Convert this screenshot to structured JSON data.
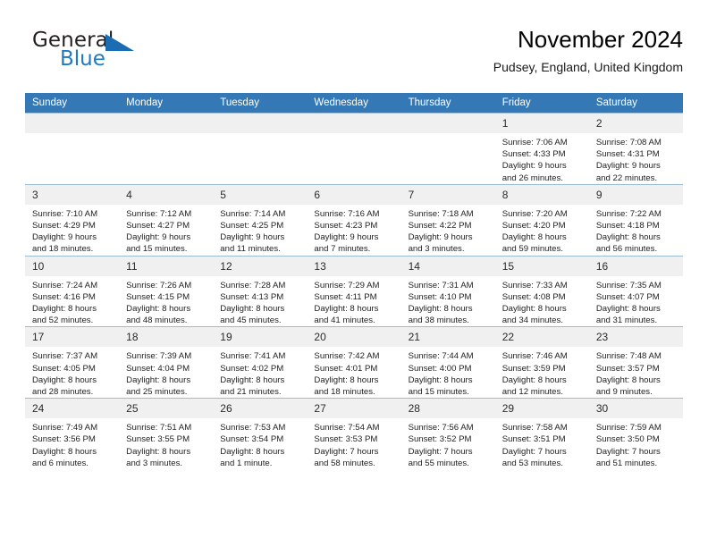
{
  "brand": {
    "name_part1": "General",
    "name_part2": "Blue",
    "logo_color": "#1b6cb3"
  },
  "header": {
    "title": "November 2024",
    "subtitle": "Pudsey, England, United Kingdom"
  },
  "theme": {
    "header_row_bg": "#3479b6",
    "daynum_bg": "#f0f0f0",
    "grid_line": "#9dbbd4"
  },
  "weekdays": [
    "Sunday",
    "Monday",
    "Tuesday",
    "Wednesday",
    "Thursday",
    "Friday",
    "Saturday"
  ],
  "labels": {
    "sunrise": "Sunrise:",
    "sunset": "Sunset:",
    "daylight": "Daylight:"
  },
  "weeks": [
    [
      {
        "day": "",
        "blank": true
      },
      {
        "day": "",
        "blank": true
      },
      {
        "day": "",
        "blank": true
      },
      {
        "day": "",
        "blank": true
      },
      {
        "day": "",
        "blank": true
      },
      {
        "day": "1",
        "sunrise": "Sunrise: 7:06 AM",
        "sunset": "Sunset: 4:33 PM",
        "daylight_line1": "Daylight: 9 hours",
        "daylight_line2": "and 26 minutes."
      },
      {
        "day": "2",
        "sunrise": "Sunrise: 7:08 AM",
        "sunset": "Sunset: 4:31 PM",
        "daylight_line1": "Daylight: 9 hours",
        "daylight_line2": "and 22 minutes."
      }
    ],
    [
      {
        "day": "3",
        "sunrise": "Sunrise: 7:10 AM",
        "sunset": "Sunset: 4:29 PM",
        "daylight_line1": "Daylight: 9 hours",
        "daylight_line2": "and 18 minutes."
      },
      {
        "day": "4",
        "sunrise": "Sunrise: 7:12 AM",
        "sunset": "Sunset: 4:27 PM",
        "daylight_line1": "Daylight: 9 hours",
        "daylight_line2": "and 15 minutes."
      },
      {
        "day": "5",
        "sunrise": "Sunrise: 7:14 AM",
        "sunset": "Sunset: 4:25 PM",
        "daylight_line1": "Daylight: 9 hours",
        "daylight_line2": "and 11 minutes."
      },
      {
        "day": "6",
        "sunrise": "Sunrise: 7:16 AM",
        "sunset": "Sunset: 4:23 PM",
        "daylight_line1": "Daylight: 9 hours",
        "daylight_line2": "and 7 minutes."
      },
      {
        "day": "7",
        "sunrise": "Sunrise: 7:18 AM",
        "sunset": "Sunset: 4:22 PM",
        "daylight_line1": "Daylight: 9 hours",
        "daylight_line2": "and 3 minutes."
      },
      {
        "day": "8",
        "sunrise": "Sunrise: 7:20 AM",
        "sunset": "Sunset: 4:20 PM",
        "daylight_line1": "Daylight: 8 hours",
        "daylight_line2": "and 59 minutes."
      },
      {
        "day": "9",
        "sunrise": "Sunrise: 7:22 AM",
        "sunset": "Sunset: 4:18 PM",
        "daylight_line1": "Daylight: 8 hours",
        "daylight_line2": "and 56 minutes."
      }
    ],
    [
      {
        "day": "10",
        "sunrise": "Sunrise: 7:24 AM",
        "sunset": "Sunset: 4:16 PM",
        "daylight_line1": "Daylight: 8 hours",
        "daylight_line2": "and 52 minutes."
      },
      {
        "day": "11",
        "sunrise": "Sunrise: 7:26 AM",
        "sunset": "Sunset: 4:15 PM",
        "daylight_line1": "Daylight: 8 hours",
        "daylight_line2": "and 48 minutes."
      },
      {
        "day": "12",
        "sunrise": "Sunrise: 7:28 AM",
        "sunset": "Sunset: 4:13 PM",
        "daylight_line1": "Daylight: 8 hours",
        "daylight_line2": "and 45 minutes."
      },
      {
        "day": "13",
        "sunrise": "Sunrise: 7:29 AM",
        "sunset": "Sunset: 4:11 PM",
        "daylight_line1": "Daylight: 8 hours",
        "daylight_line2": "and 41 minutes."
      },
      {
        "day": "14",
        "sunrise": "Sunrise: 7:31 AM",
        "sunset": "Sunset: 4:10 PM",
        "daylight_line1": "Daylight: 8 hours",
        "daylight_line2": "and 38 minutes."
      },
      {
        "day": "15",
        "sunrise": "Sunrise: 7:33 AM",
        "sunset": "Sunset: 4:08 PM",
        "daylight_line1": "Daylight: 8 hours",
        "daylight_line2": "and 34 minutes."
      },
      {
        "day": "16",
        "sunrise": "Sunrise: 7:35 AM",
        "sunset": "Sunset: 4:07 PM",
        "daylight_line1": "Daylight: 8 hours",
        "daylight_line2": "and 31 minutes."
      }
    ],
    [
      {
        "day": "17",
        "sunrise": "Sunrise: 7:37 AM",
        "sunset": "Sunset: 4:05 PM",
        "daylight_line1": "Daylight: 8 hours",
        "daylight_line2": "and 28 minutes."
      },
      {
        "day": "18",
        "sunrise": "Sunrise: 7:39 AM",
        "sunset": "Sunset: 4:04 PM",
        "daylight_line1": "Daylight: 8 hours",
        "daylight_line2": "and 25 minutes."
      },
      {
        "day": "19",
        "sunrise": "Sunrise: 7:41 AM",
        "sunset": "Sunset: 4:02 PM",
        "daylight_line1": "Daylight: 8 hours",
        "daylight_line2": "and 21 minutes."
      },
      {
        "day": "20",
        "sunrise": "Sunrise: 7:42 AM",
        "sunset": "Sunset: 4:01 PM",
        "daylight_line1": "Daylight: 8 hours",
        "daylight_line2": "and 18 minutes."
      },
      {
        "day": "21",
        "sunrise": "Sunrise: 7:44 AM",
        "sunset": "Sunset: 4:00 PM",
        "daylight_line1": "Daylight: 8 hours",
        "daylight_line2": "and 15 minutes."
      },
      {
        "day": "22",
        "sunrise": "Sunrise: 7:46 AM",
        "sunset": "Sunset: 3:59 PM",
        "daylight_line1": "Daylight: 8 hours",
        "daylight_line2": "and 12 minutes."
      },
      {
        "day": "23",
        "sunrise": "Sunrise: 7:48 AM",
        "sunset": "Sunset: 3:57 PM",
        "daylight_line1": "Daylight: 8 hours",
        "daylight_line2": "and 9 minutes."
      }
    ],
    [
      {
        "day": "24",
        "sunrise": "Sunrise: 7:49 AM",
        "sunset": "Sunset: 3:56 PM",
        "daylight_line1": "Daylight: 8 hours",
        "daylight_line2": "and 6 minutes."
      },
      {
        "day": "25",
        "sunrise": "Sunrise: 7:51 AM",
        "sunset": "Sunset: 3:55 PM",
        "daylight_line1": "Daylight: 8 hours",
        "daylight_line2": "and 3 minutes."
      },
      {
        "day": "26",
        "sunrise": "Sunrise: 7:53 AM",
        "sunset": "Sunset: 3:54 PM",
        "daylight_line1": "Daylight: 8 hours",
        "daylight_line2": "and 1 minute."
      },
      {
        "day": "27",
        "sunrise": "Sunrise: 7:54 AM",
        "sunset": "Sunset: 3:53 PM",
        "daylight_line1": "Daylight: 7 hours",
        "daylight_line2": "and 58 minutes."
      },
      {
        "day": "28",
        "sunrise": "Sunrise: 7:56 AM",
        "sunset": "Sunset: 3:52 PM",
        "daylight_line1": "Daylight: 7 hours",
        "daylight_line2": "and 55 minutes."
      },
      {
        "day": "29",
        "sunrise": "Sunrise: 7:58 AM",
        "sunset": "Sunset: 3:51 PM",
        "daylight_line1": "Daylight: 7 hours",
        "daylight_line2": "and 53 minutes."
      },
      {
        "day": "30",
        "sunrise": "Sunrise: 7:59 AM",
        "sunset": "Sunset: 3:50 PM",
        "daylight_line1": "Daylight: 7 hours",
        "daylight_line2": "and 51 minutes."
      }
    ]
  ]
}
